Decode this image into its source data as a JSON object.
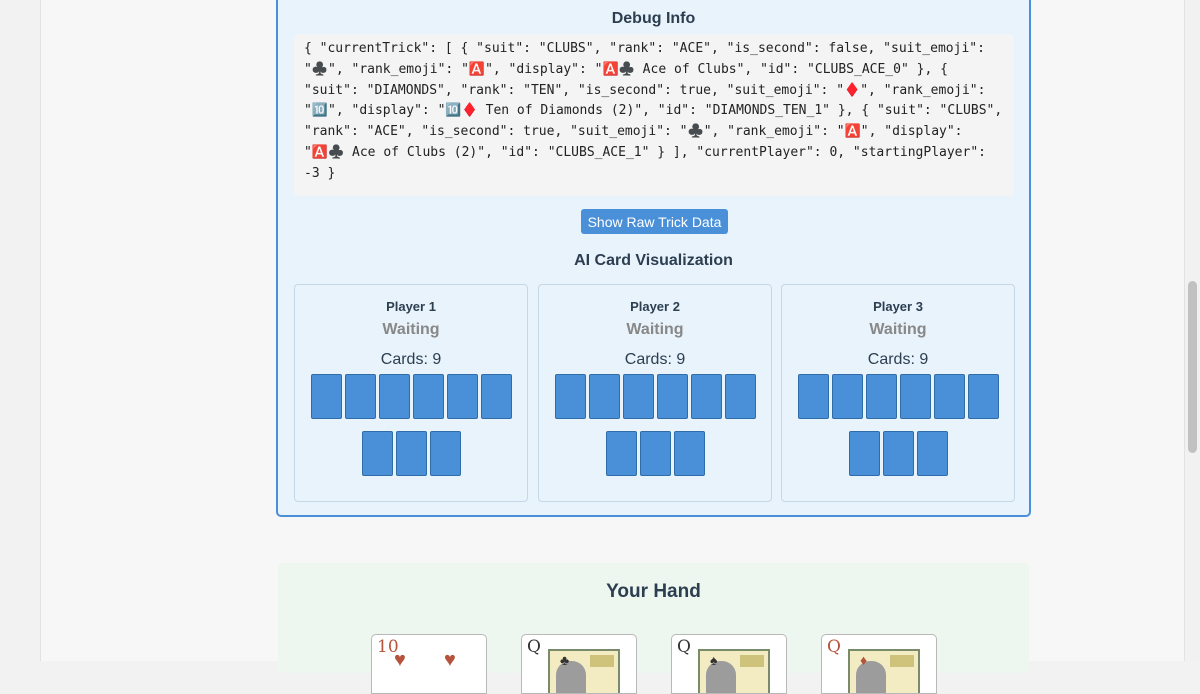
{
  "debug": {
    "title": "Debug Info",
    "json_text": "{ \"currentTrick\": [ { \"suit\": \"CLUBS\", \"rank\": \"ACE\", \"is_second\": false, \"suit_emoji\": \"♣️\", \"rank_emoji\": \"🅰️\", \"display\": \"🅰️♣️ Ace of Clubs\", \"id\": \"CLUBS_ACE_0\" }, { \"suit\": \"DIAMONDS\", \"rank\": \"TEN\", \"is_second\": true, \"suit_emoji\": \"♦️\", \"rank_emoji\": \"🔟\", \"display\": \"🔟♦️ Ten of Diamonds (2)\", \"id\": \"DIAMONDS_TEN_1\" }, { \"suit\": \"CLUBS\", \"rank\": \"ACE\", \"is_second\": true, \"suit_emoji\": \"♣️\", \"rank_emoji\": \"🅰️\", \"display\": \"🅰️♣️ Ace of Clubs (2)\", \"id\": \"CLUBS_ACE_1\" } ], \"currentPlayer\": 0, \"startingPlayer\": -3 }",
    "raw_button_label": "Show Raw Trick Data"
  },
  "ai_viz": {
    "title": "AI Card Visualization",
    "players": [
      {
        "name": "Player 1",
        "status": "Waiting",
        "cards_text": "Cards: 9",
        "card_count": 9
      },
      {
        "name": "Player 2",
        "status": "Waiting",
        "cards_text": "Cards: 9",
        "card_count": 9
      },
      {
        "name": "Player 3",
        "status": "Waiting",
        "cards_text": "Cards: 9",
        "card_count": 9
      }
    ]
  },
  "hand": {
    "title": "Your Hand",
    "cards": [
      {
        "rank": "10",
        "suit": "♥",
        "suit_name": "hearts",
        "color": "#b5533c"
      },
      {
        "rank": "Q",
        "suit": "♣",
        "suit_name": "clubs",
        "color": "#333333"
      },
      {
        "rank": "Q",
        "suit": "♠",
        "suit_name": "spades",
        "color": "#333333"
      },
      {
        "rank": "Q",
        "suit": "♦",
        "suit_name": "diamonds",
        "color": "#b5533c"
      }
    ]
  },
  "colors": {
    "accent": "#4a90d9",
    "debug_bg": "#e8f3fc",
    "hand_bg": "#edf7f0",
    "status_gray": "#888888"
  }
}
